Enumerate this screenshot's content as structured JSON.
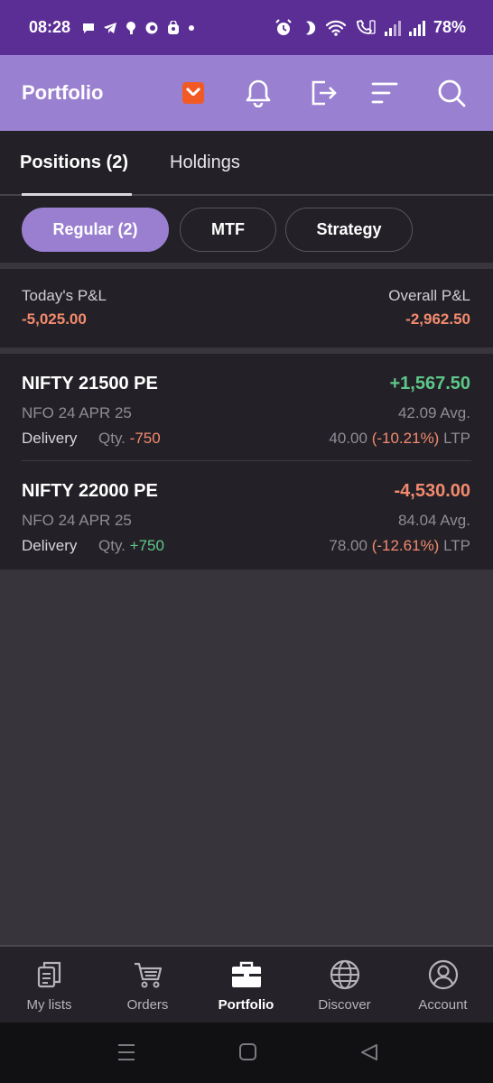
{
  "status_bar": {
    "time": "08:28",
    "battery": "78%",
    "notification_icons": [
      "chat-icon",
      "telegram-icon",
      "app-icon",
      "c-icon",
      "bag-icon",
      "dot-icon"
    ],
    "status_icons": [
      "alarm-icon",
      "moon-icon",
      "wifi-icon",
      "volte-icon",
      "signal-icon",
      "signal-icon"
    ]
  },
  "app_bar": {
    "title": "Portfolio",
    "actions": [
      "brand-app-icon",
      "bell-icon",
      "logout-icon",
      "sort-icon",
      "search-icon"
    ],
    "brand_color": "#f15a24"
  },
  "tabs": [
    {
      "label": "Positions (2)",
      "active": true
    },
    {
      "label": "Holdings",
      "active": false
    }
  ],
  "filters": [
    {
      "label": "Regular (2)",
      "active": true
    },
    {
      "label": "MTF",
      "active": false
    },
    {
      "label": "Strategy",
      "active": false
    }
  ],
  "pnl": {
    "today_label": "Today's P&L",
    "today_value": "-5,025.00",
    "overall_label": "Overall P&L",
    "overall_value": "-2,962.50"
  },
  "positions": [
    {
      "name": "NIFTY 21500 PE",
      "pnl": "+1,567.50",
      "pnl_color": "green",
      "exchange": "NFO 24 APR 25",
      "avg": "42.09 Avg.",
      "product": "Delivery",
      "qty_label": "Qty.",
      "qty_value": "-750",
      "ltp_price": "40.00",
      "ltp_change": "(-10.21%)",
      "ltp_label": "LTP"
    },
    {
      "name": "NIFTY 22000 PE",
      "pnl": "-4,530.00",
      "pnl_color": "red",
      "exchange": "NFO 24 APR 25",
      "avg": "84.04 Avg.",
      "product": "Delivery",
      "qty_label": "Qty.",
      "qty_value": "+750",
      "ltp_price": "78.00",
      "ltp_change": "(-12.61%)",
      "ltp_label": "LTP"
    }
  ],
  "bottom_nav": [
    {
      "label": "My lists",
      "icon": "lists-icon",
      "active": false
    },
    {
      "label": "Orders",
      "icon": "cart-icon",
      "active": false
    },
    {
      "label": "Portfolio",
      "icon": "briefcase-icon",
      "active": true
    },
    {
      "label": "Discover",
      "icon": "globe-icon",
      "active": false
    },
    {
      "label": "Account",
      "icon": "account-icon",
      "active": false
    }
  ],
  "colors": {
    "status_bar": "#5b2e96",
    "app_bar": "#9a80d0",
    "accent": "#9a7fd1",
    "positive": "#5fc78a",
    "negative": "#f38a6e"
  }
}
